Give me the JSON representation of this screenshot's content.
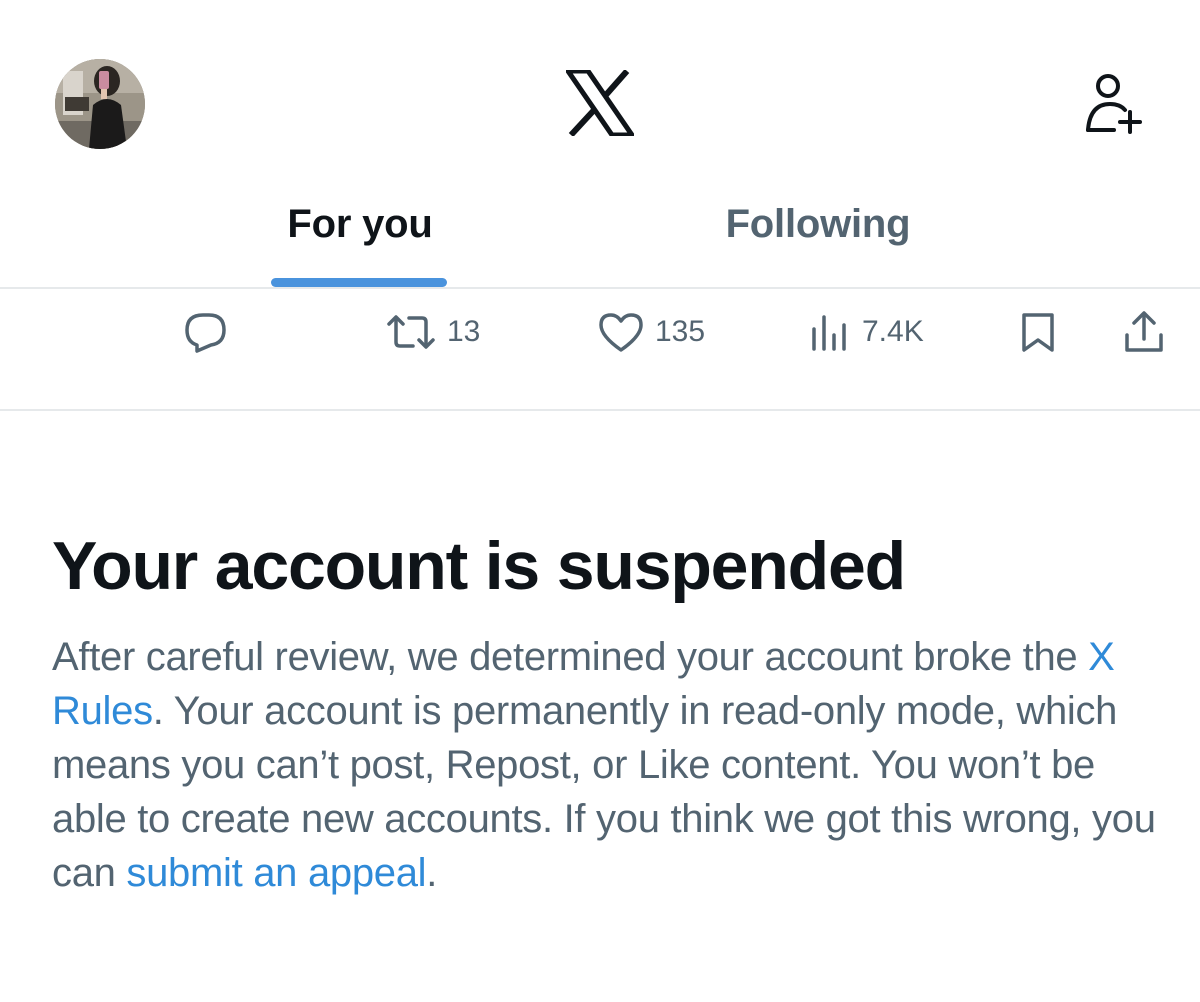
{
  "header": {
    "avatar_icon": "profile-photo",
    "logo_icon": "x-logo",
    "add_user_icon": "add-user-icon"
  },
  "tabs": [
    {
      "label": "For you",
      "active": true
    },
    {
      "label": "Following",
      "active": false
    }
  ],
  "actions": {
    "reply_count": "",
    "repost_count": "13",
    "like_count": "135",
    "views_count": "7.4K"
  },
  "suspension": {
    "title": "Your account is suspended",
    "body_1": "After careful review, we determined your account broke the ",
    "rules_link": "X Rules",
    "body_2": ". Your account is permanently in read-only mode, which means you can’t post, Repost, or Like content. You won’t be able to create new accounts. If you think we got this wrong, you can ",
    "appeal_link": "submit an appeal",
    "body_3": "."
  },
  "colors": {
    "text_primary": "#0f1419",
    "text_secondary": "#536471",
    "link": "#2f8ad8",
    "tab_indicator": "#4a93dd",
    "divider": "#e6e9eb"
  }
}
